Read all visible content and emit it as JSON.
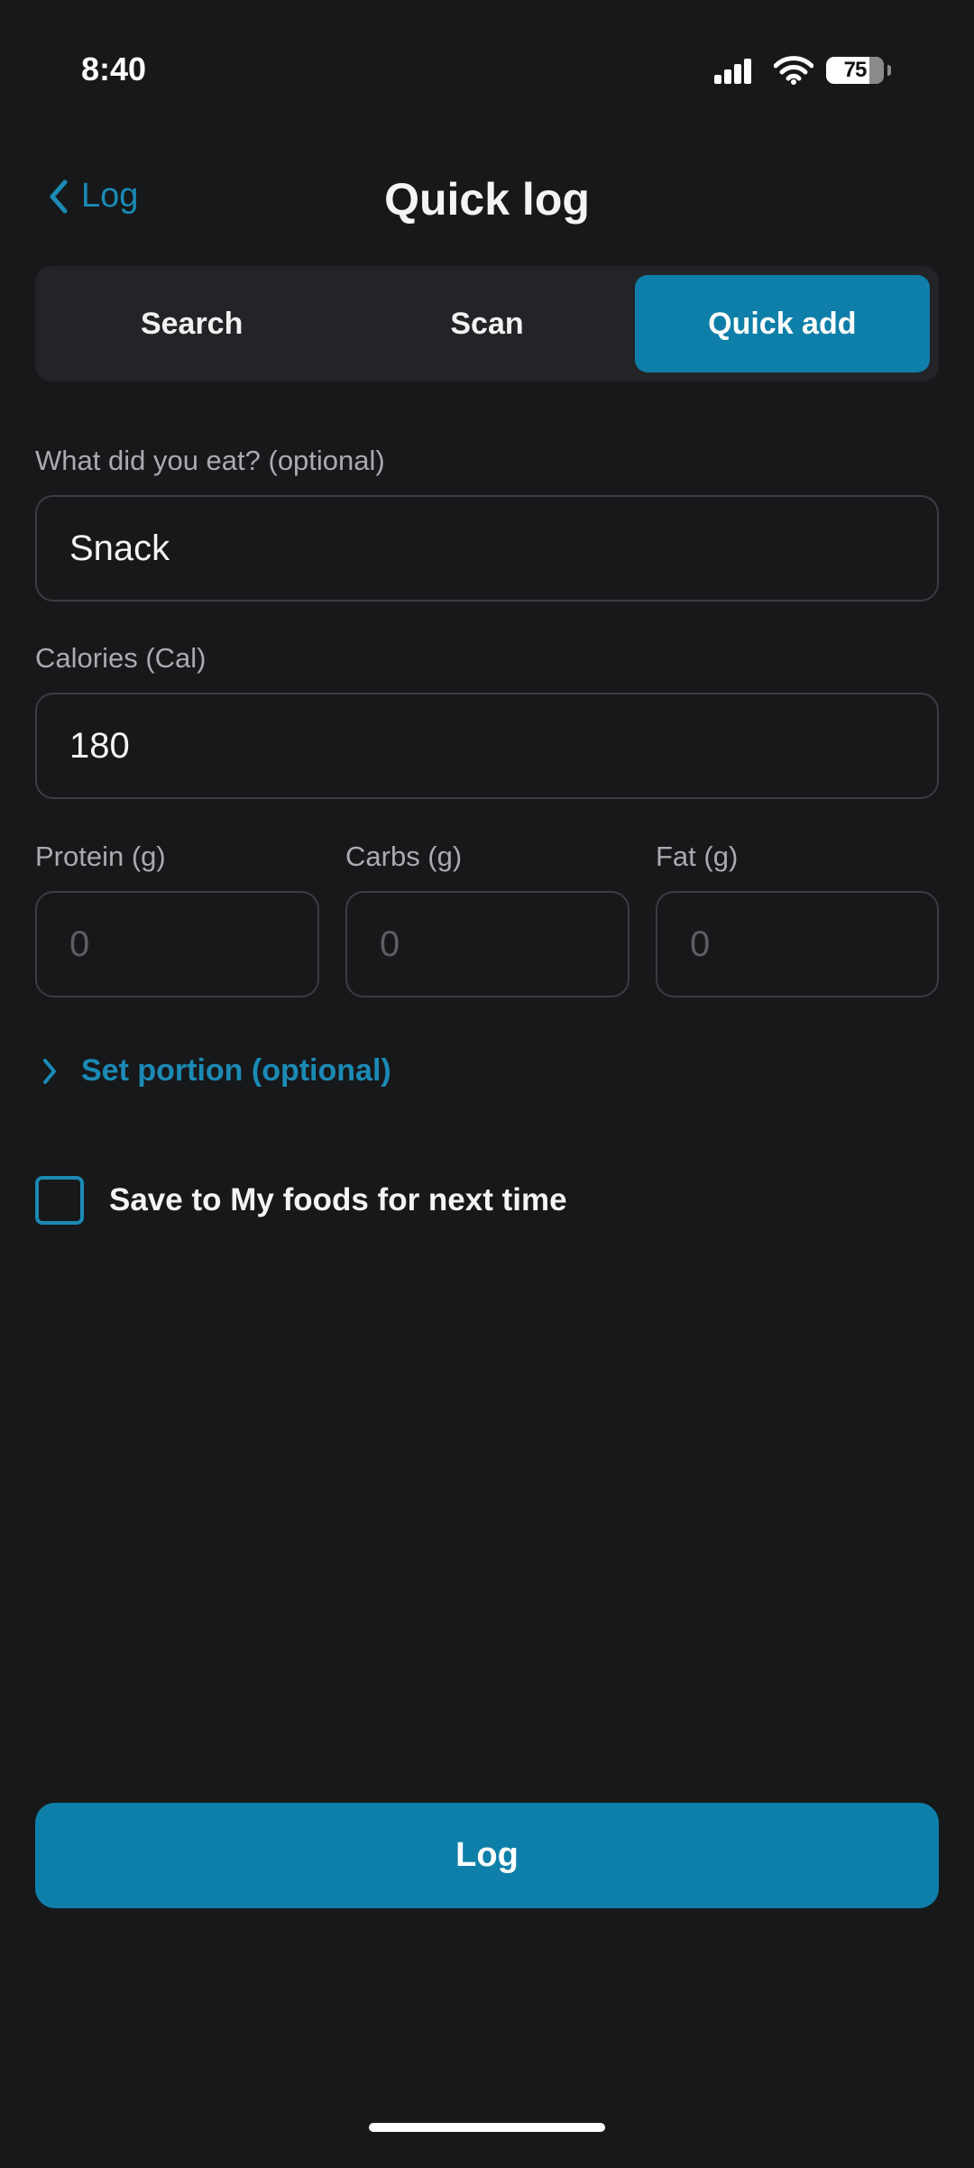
{
  "status_bar": {
    "time": "8:40",
    "battery": "75",
    "icons": [
      "signal-icon",
      "wifi-icon",
      "battery-icon"
    ]
  },
  "header": {
    "back_label": "Log",
    "title": "Quick log"
  },
  "tabs": [
    {
      "label": "Search",
      "active": false
    },
    {
      "label": "Scan",
      "active": false
    },
    {
      "label": "Quick add",
      "active": true
    }
  ],
  "form": {
    "name_label": "What did you eat? (optional)",
    "name_value": "Snack",
    "calories_label": "Calories (Cal)",
    "calories_value": "180",
    "protein_label": "Protein (g)",
    "protein_placeholder": "0",
    "carbs_label": "Carbs (g)",
    "carbs_placeholder": "0",
    "fat_label": "Fat (g)",
    "fat_placeholder": "0",
    "portion_link": "Set portion (optional)",
    "save_label": "Save to My foods for next time",
    "save_checked": false
  },
  "log_button": "Log",
  "colors": {
    "background": "#17181a",
    "accent": "#0e7fa8",
    "link": "#1b8ab5",
    "field_border": "#3b3d41"
  }
}
